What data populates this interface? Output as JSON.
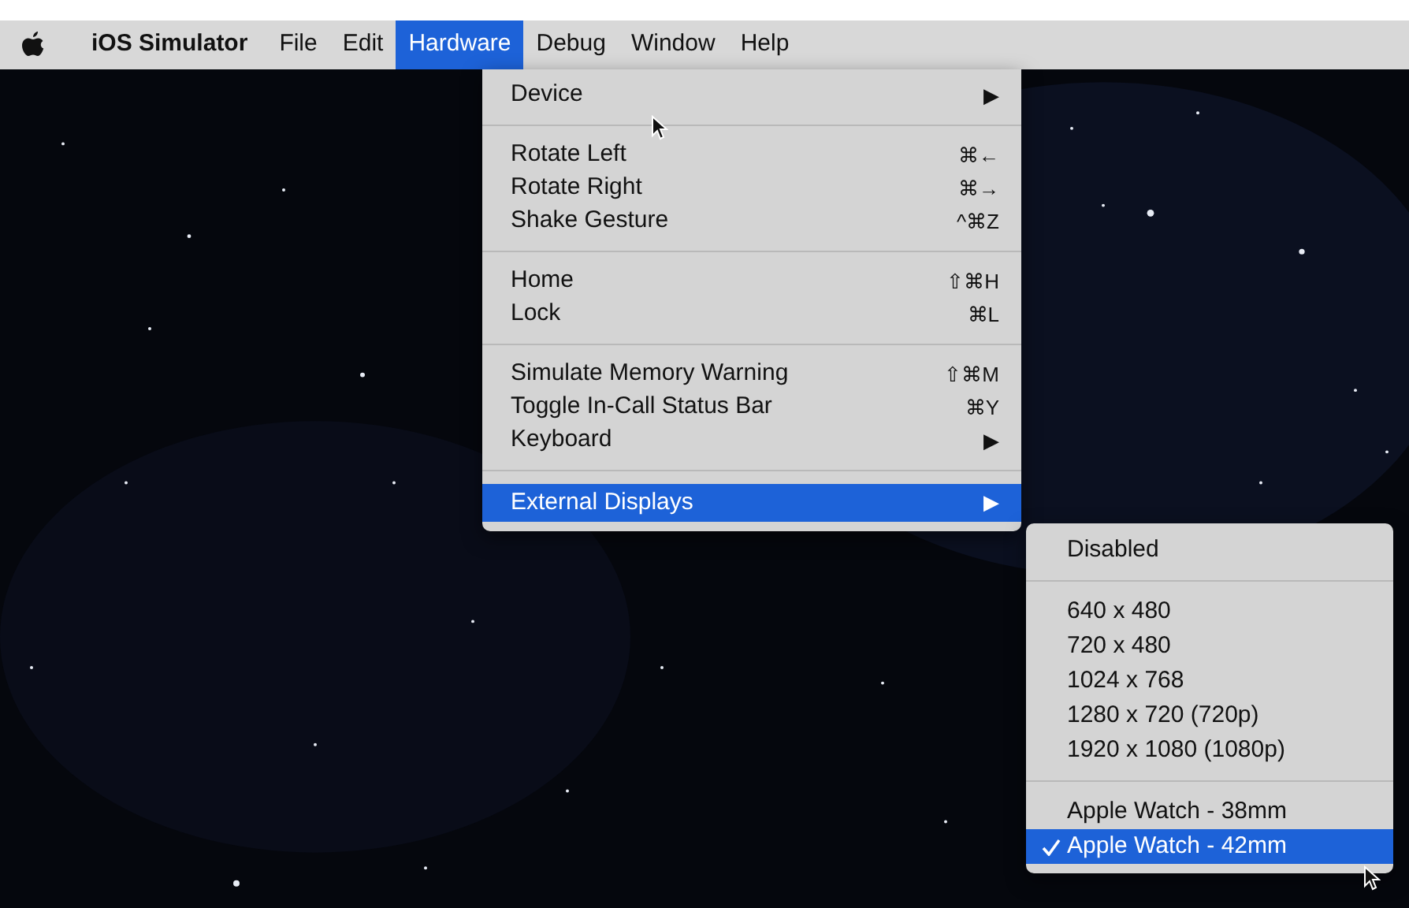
{
  "menubar": [
    {
      "label": "iOS Simulator",
      "kind": "app",
      "selected": false
    },
    {
      "label": "File",
      "kind": "menu",
      "selected": false
    },
    {
      "label": "Edit",
      "kind": "menu",
      "selected": false
    },
    {
      "label": "Hardware",
      "kind": "menu",
      "selected": true
    },
    {
      "label": "Debug",
      "kind": "menu",
      "selected": false
    },
    {
      "label": "Window",
      "kind": "menu",
      "selected": false
    },
    {
      "label": "Help",
      "kind": "menu",
      "selected": false
    }
  ],
  "menu": [
    {
      "kind": "item",
      "label": "Device",
      "shortcut": "▶",
      "selected": false
    },
    {
      "kind": "separator"
    },
    {
      "kind": "item",
      "label": "Rotate Left",
      "shortcut": "⌘←",
      "selected": false
    },
    {
      "kind": "item",
      "label": "Rotate Right",
      "shortcut": "⌘→",
      "selected": false
    },
    {
      "kind": "item",
      "label": "Shake Gesture",
      "shortcut": "^⌘Z",
      "selected": false
    },
    {
      "kind": "separator"
    },
    {
      "kind": "item",
      "label": "Home",
      "shortcut": "⇧⌘H",
      "selected": false
    },
    {
      "kind": "item",
      "label": "Lock",
      "shortcut": "⌘L",
      "selected": false
    },
    {
      "kind": "separator"
    },
    {
      "kind": "item",
      "label": "Simulate Memory Warning",
      "shortcut": "⇧⌘M",
      "selected": false
    },
    {
      "kind": "item",
      "label": "Toggle In-Call Status Bar",
      "shortcut": "⌘Y",
      "selected": false
    },
    {
      "kind": "item",
      "label": "Keyboard",
      "shortcut": "▶",
      "selected": false
    },
    {
      "kind": "separator"
    },
    {
      "kind": "item",
      "label": "External Displays",
      "shortcut": "▶",
      "selected": true
    }
  ],
  "submenu": [
    {
      "kind": "item",
      "label": "Disabled",
      "checked": false,
      "selected": false
    },
    {
      "kind": "separator"
    },
    {
      "kind": "item",
      "label": "640 x 480",
      "checked": false,
      "selected": false
    },
    {
      "kind": "item",
      "label": "720 x 480",
      "checked": false,
      "selected": false
    },
    {
      "kind": "item",
      "label": "1024 x 768",
      "checked": false,
      "selected": false
    },
    {
      "kind": "item",
      "label": "1280 x 720 (720p)",
      "checked": false,
      "selected": false
    },
    {
      "kind": "item",
      "label": "1920 x 1080 (1080p)",
      "checked": false,
      "selected": false
    },
    {
      "kind": "separator"
    },
    {
      "kind": "item",
      "label": "Apple Watch - 38mm",
      "checked": false,
      "selected": false
    },
    {
      "kind": "item",
      "label": "Apple Watch - 42mm",
      "checked": true,
      "selected": true
    }
  ]
}
